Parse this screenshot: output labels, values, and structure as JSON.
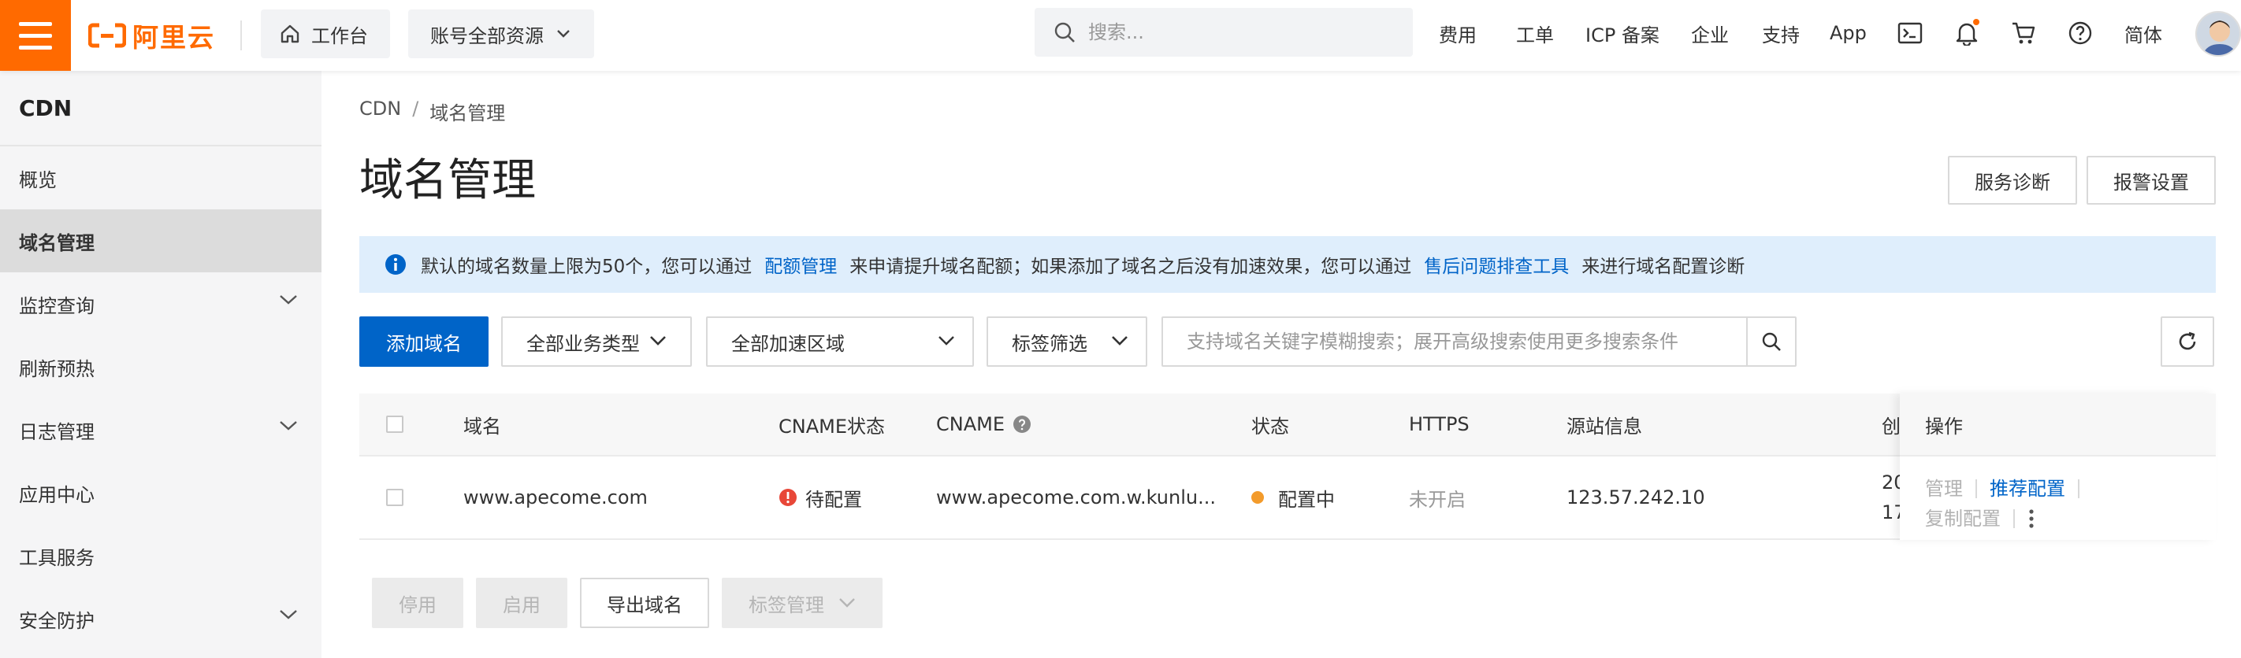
{
  "topbar": {
    "logo_text": "阿里云",
    "workbench_label": "工作台",
    "resources_label": "账号全部资源",
    "search_placeholder": "搜索...",
    "nav": [
      "费用",
      "工单",
      "ICP 备案",
      "企业",
      "支持",
      "App"
    ],
    "lang_label": "简体",
    "brand_color": "#ff6a00",
    "icons": [
      "terminal-icon",
      "bell-icon",
      "cart-icon",
      "help-icon"
    ]
  },
  "sidebar": {
    "title": "CDN",
    "items": [
      {
        "label": "概览"
      },
      {
        "label": "域名管理",
        "active": true
      },
      {
        "label": "监控查询",
        "expandable": true
      },
      {
        "label": "刷新预热"
      },
      {
        "label": "日志管理",
        "expandable": true
      },
      {
        "label": "应用中心"
      },
      {
        "label": "工具服务"
      },
      {
        "label": "安全防护",
        "expandable": true
      }
    ]
  },
  "main": {
    "breadcrumb": [
      "CDN",
      "域名管理"
    ],
    "title": "域名管理",
    "header_buttons": {
      "diagnose": "服务诊断",
      "alert": "报警设置"
    },
    "notice": {
      "text1": "默认的域名数量上限为50个，您可以通过",
      "link1": "配额管理",
      "text2": "来申请提升域名配额；如果添加了域名之后没有加速效果，您可以通过",
      "link2": "售后问题排查工具",
      "text3": "来进行域名配置诊断"
    },
    "toolbar": {
      "add_domain": "添加域名",
      "biz_type": "全部业务类型",
      "area": "全部加速区域",
      "tag_filter": "标签筛选",
      "search_placeholder": "支持域名关键字模糊搜索；展开高级搜索使用更多搜索条件"
    },
    "table": {
      "headers": {
        "domain": "域名",
        "cname_status": "CNAME状态",
        "cname": "CNAME",
        "status": "状态",
        "https": "HTTPS",
        "origin": "源站信息",
        "created": "创",
        "ops": "操作"
      },
      "rows": [
        {
          "domain": "www.apecome.com",
          "cname_status": "待配置",
          "cname": "www.apecome.com.w.kunlu...",
          "status": "配置中",
          "https": "未开启",
          "origin": "123.57.242.10",
          "created_line1": "20",
          "created_line2": "17",
          "ops": {
            "manage": "管理",
            "recommend": "推荐配置",
            "copy": "复制配置"
          }
        }
      ]
    },
    "footer": {
      "stop": "停用",
      "start": "启用",
      "export": "导出域名",
      "tag_manage": "标签管理"
    },
    "colors": {
      "primary": "#0064c8",
      "notice_bg": "#dfeefc",
      "warning": "#f39b2b",
      "error": "#e84738"
    }
  }
}
